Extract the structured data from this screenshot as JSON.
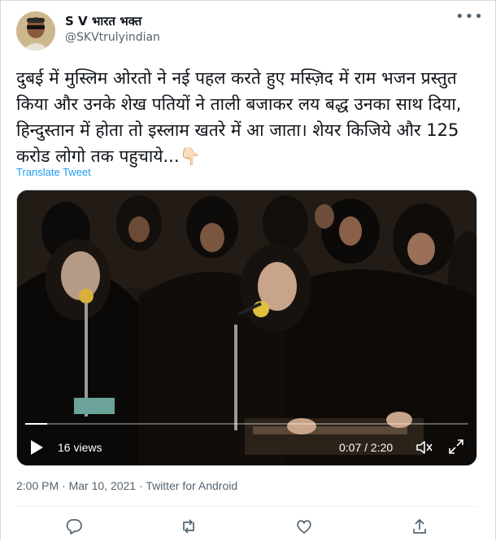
{
  "author": {
    "display_name": "S V भारत भक्त",
    "handle": "@SKVtrulyindian",
    "avatar_icon": "avatar-photo"
  },
  "more_icon": "more-options-icon",
  "tweet": {
    "text": "दुबई में मुस्लिम ओरतो ने नई पहल करते हुए मस्ज़िद में राम भजन प्रस्तुत किया और उनके शेख पतियों ने ताली बजाकर लय बद्ध उनका साथ दिया, हिन्दुस्तान में होता तो इस्लाम खतरे में आ जाता। शेयर किजिये और 125 करोड लोगो तक पहुचाये...👇🏻",
    "translate_label": "Translate Tweet"
  },
  "video": {
    "views": "16 views",
    "time": "0:07 / 2:20",
    "progress": 0.05,
    "controls": [
      "play-icon",
      "volume-icon",
      "fullscreen-icon"
    ]
  },
  "meta": {
    "time": "2:00 PM",
    "separator": " · ",
    "date": "Mar 10, 2021",
    "source": "Twitter for Android"
  },
  "actions": [
    "reply-icon",
    "retweet-icon",
    "like-icon",
    "share-icon"
  ],
  "colors": {
    "link": "#1d9bf0",
    "secondary_text": "#536471",
    "border": "#cfd9de"
  }
}
